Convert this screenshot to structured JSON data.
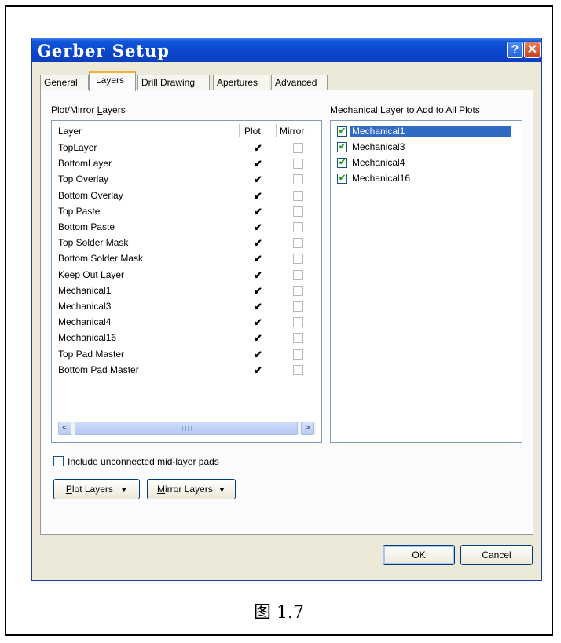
{
  "window": {
    "title": "Gerber Setup",
    "help_glyph": "?",
    "close_glyph": "✕"
  },
  "tabs": [
    {
      "label": "General"
    },
    {
      "label": "Layers"
    },
    {
      "label": "Drill Drawing"
    },
    {
      "label": "Apertures"
    },
    {
      "label": "Advanced"
    }
  ],
  "plot_mirror": {
    "group_label": "Plot/Mirror Layers",
    "columns": {
      "layer": "Layer",
      "plot": "Plot",
      "mirror": "Mirror"
    },
    "rows": [
      {
        "layer": "TopLayer",
        "plot": true,
        "mirror": false
      },
      {
        "layer": "BottomLayer",
        "plot": true,
        "mirror": false
      },
      {
        "layer": "Top Overlay",
        "plot": true,
        "mirror": false
      },
      {
        "layer": "Bottom Overlay",
        "plot": true,
        "mirror": false
      },
      {
        "layer": "Top Paste",
        "plot": true,
        "mirror": false
      },
      {
        "layer": "Bottom Paste",
        "plot": true,
        "mirror": false
      },
      {
        "layer": "Top Solder Mask",
        "plot": true,
        "mirror": false
      },
      {
        "layer": "Bottom Solder Mask",
        "plot": true,
        "mirror": false
      },
      {
        "layer": "Keep Out Layer",
        "plot": true,
        "mirror": false
      },
      {
        "layer": "Mechanical1",
        "plot": true,
        "mirror": false
      },
      {
        "layer": "Mechanical3",
        "plot": true,
        "mirror": false
      },
      {
        "layer": "Mechanical4",
        "plot": true,
        "mirror": false
      },
      {
        "layer": "Mechanical16",
        "plot": true,
        "mirror": false
      },
      {
        "layer": "Top Pad Master",
        "plot": true,
        "mirror": false
      },
      {
        "layer": "Bottom Pad Master",
        "plot": true,
        "mirror": false
      }
    ],
    "check_glyph": "✔",
    "scroll_left": "<",
    "scroll_right": ">"
  },
  "mechanical": {
    "label": "Mechanical Layer to Add to All Plots",
    "items": [
      {
        "label": "Mechanical1",
        "checked": true,
        "selected": true
      },
      {
        "label": "Mechanical3",
        "checked": true,
        "selected": false
      },
      {
        "label": "Mechanical4",
        "checked": true,
        "selected": false
      },
      {
        "label": "Mechanical16",
        "checked": true,
        "selected": false
      }
    ],
    "check_glyph": "✔"
  },
  "include_unconnected": {
    "label": "Include unconnected mid-layer pads",
    "checked": false
  },
  "buttons": {
    "plot_layers": "Plot Layers",
    "mirror_layers": "Mirror Layers",
    "dropdown_glyph": "▼",
    "ok": "OK",
    "cancel": "Cancel"
  },
  "caption": "图 1.7"
}
